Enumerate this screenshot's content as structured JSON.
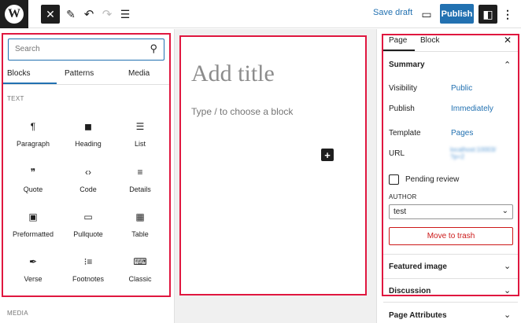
{
  "toolbar": {
    "logo_glyph": "W",
    "close_glyph": "✕",
    "edit_glyph": "✎",
    "undo_glyph": "↶",
    "redo_glyph": "↷",
    "list_glyph": "☰",
    "save_draft_label": "Save draft",
    "preview_glyph": "▭",
    "publish_label": "Publish",
    "settings_glyph": "◧",
    "more_glyph": "⋮"
  },
  "inserter": {
    "search_placeholder": "Search",
    "search_glyph": "⚲",
    "tabs": [
      "Blocks",
      "Patterns",
      "Media"
    ],
    "active_tab": "Blocks",
    "section_title": "TEXT",
    "blocks": [
      {
        "label": "Paragraph",
        "icon": "paragraph-icon",
        "glyph": "¶"
      },
      {
        "label": "Heading",
        "icon": "heading-icon",
        "glyph": "◼"
      },
      {
        "label": "List",
        "icon": "list-icon",
        "glyph": "☰"
      },
      {
        "label": "Quote",
        "icon": "quote-icon",
        "glyph": "❞"
      },
      {
        "label": "Code",
        "icon": "code-icon",
        "glyph": "‹›"
      },
      {
        "label": "Details",
        "icon": "details-icon",
        "glyph": "≡"
      },
      {
        "label": "Preformatted",
        "icon": "preformatted-icon",
        "glyph": "▣"
      },
      {
        "label": "Pullquote",
        "icon": "pullquote-icon",
        "glyph": "▭"
      },
      {
        "label": "Table",
        "icon": "table-icon",
        "glyph": "▦"
      },
      {
        "label": "Verse",
        "icon": "verse-icon",
        "glyph": "✒"
      },
      {
        "label": "Footnotes",
        "icon": "footnotes-icon",
        "glyph": "⁝≡"
      },
      {
        "label": "Classic",
        "icon": "classic-icon",
        "glyph": "⌨"
      }
    ],
    "next_section_title": "MEDIA"
  },
  "editor": {
    "title_placeholder": "Add title",
    "block_hint": "Type / to choose a block",
    "add_block_glyph": "+"
  },
  "sidebar": {
    "tabs": [
      "Page",
      "Block"
    ],
    "active_tab": "Page",
    "close_glyph": "✕",
    "summary": {
      "title": "Summary",
      "expanded": true,
      "visibility_label": "Visibility",
      "visibility_value": "Public",
      "publish_label": "Publish",
      "publish_value": "Immediately",
      "template_label": "Template",
      "template_value": "Pages",
      "url_label": "URL",
      "url_value_line1": "localhost:10003/",
      "url_value_line2": "?p=2",
      "pending_review_label": "Pending review",
      "pending_review_checked": false,
      "author_label": "AUTHOR",
      "author_value": "test",
      "trash_label": "Move to trash"
    },
    "panels": [
      "Featured image",
      "Discussion",
      "Page Attributes"
    ]
  },
  "colors": {
    "accent": "#2271b1",
    "highlight_outline": "#e0173f",
    "danger": "#cc1818",
    "dark": "#1e1e1e"
  }
}
